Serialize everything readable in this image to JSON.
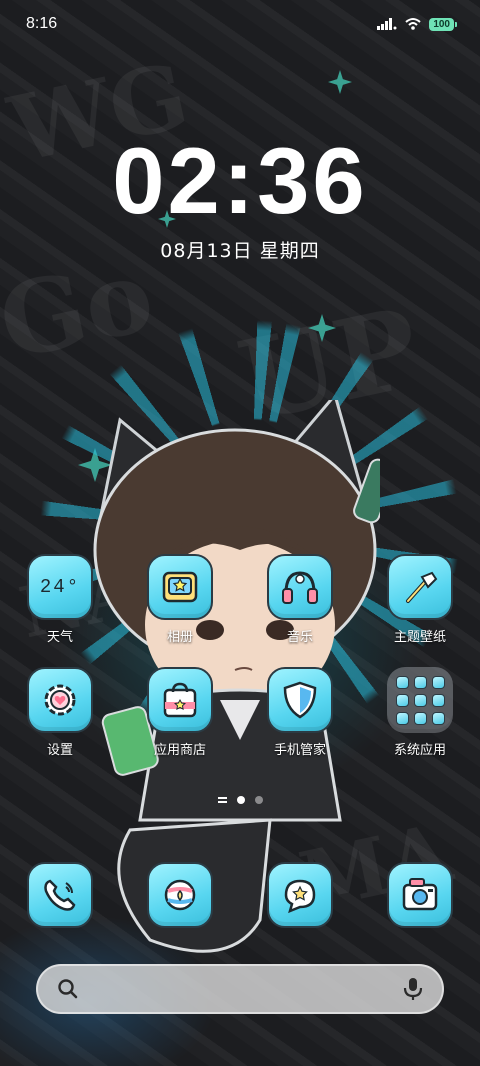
{
  "status_bar": {
    "time": "8:16",
    "battery": "100"
  },
  "lockclock": {
    "time": "02:36",
    "date": "08月13日 星期四"
  },
  "apps": [
    {
      "label": "天气",
      "icon": "weather-icon",
      "temp": "24°"
    },
    {
      "label": "相册",
      "icon": "gallery-icon"
    },
    {
      "label": "音乐",
      "icon": "music-icon"
    },
    {
      "label": "主题壁纸",
      "icon": "theme-brush-icon"
    },
    {
      "label": "设置",
      "icon": "settings-gear-icon"
    },
    {
      "label": "应用商店",
      "icon": "app-store-bag-icon"
    },
    {
      "label": "手机管家",
      "icon": "security-shield-icon"
    },
    {
      "label": "系统应用",
      "icon": "folder-icon"
    }
  ],
  "dock": [
    {
      "icon": "phone-icon"
    },
    {
      "icon": "browser-icon"
    },
    {
      "icon": "messages-icon"
    },
    {
      "icon": "camera-icon"
    }
  ],
  "page_indicator": {
    "pages": 2,
    "active": 1
  },
  "colors": {
    "icon_accent": "#58d6f0",
    "battery": "#6fe3b6",
    "wallpaper_glow": "#28bedc"
  }
}
